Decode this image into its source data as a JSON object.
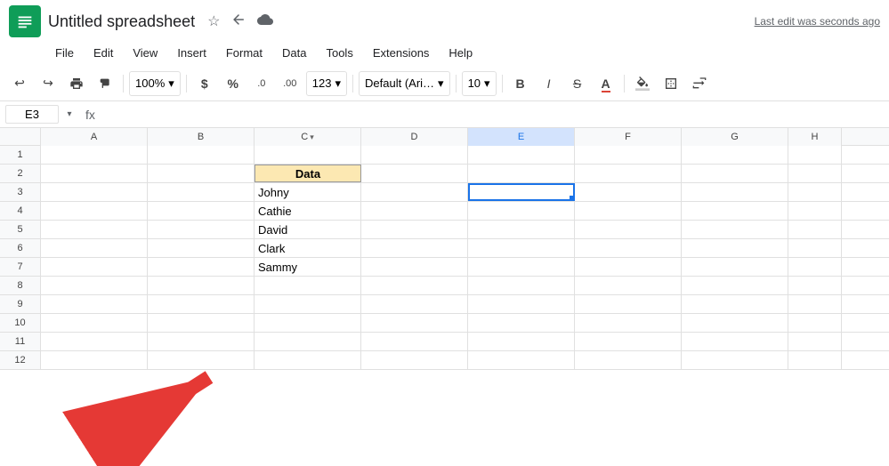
{
  "title": "Untitled spreadsheet",
  "icons": {
    "star": "☆",
    "drive": "🗂",
    "cloud": "☁",
    "undo": "↩",
    "redo": "↪",
    "print": "🖨",
    "paintformat": "🖌",
    "zoom": "100%",
    "zoom_arrow": "▾",
    "dollar": "$",
    "percent": "%",
    "decimal_decrease": ".0",
    "decimal_increase": ".00",
    "format_number": "123",
    "font": "Default (Ari…",
    "font_arrow": "▾",
    "font_size": "10",
    "font_size_arrow": "▾",
    "bold": "B",
    "italic": "I",
    "strikethrough": "S",
    "text_color": "A",
    "fill_color": "🪣",
    "borders": "⊞",
    "merge": "⊡"
  },
  "menu": {
    "items": [
      "File",
      "Edit",
      "View",
      "Insert",
      "Format",
      "Data",
      "Tools",
      "Extensions",
      "Help"
    ]
  },
  "last_edit": "Last edit was seconds ago",
  "formula_bar": {
    "cell_ref": "E3",
    "formula_icon": "fx",
    "formula_value": ""
  },
  "columns": [
    "A",
    "B",
    "C",
    "D",
    "E",
    "F",
    "G",
    "H"
  ],
  "rows": [
    1,
    2,
    3,
    4,
    5,
    6,
    7,
    8,
    9,
    10,
    11,
    12
  ],
  "cells": {
    "C2": {
      "value": "Data",
      "style": "data-header"
    },
    "C3": {
      "value": "Johny"
    },
    "C4": {
      "value": "Cathie"
    },
    "C5": {
      "value": "David"
    },
    "C6": {
      "value": "Clark"
    },
    "C7": {
      "value": "Sammy"
    },
    "E3": {
      "value": "",
      "style": "active"
    }
  }
}
